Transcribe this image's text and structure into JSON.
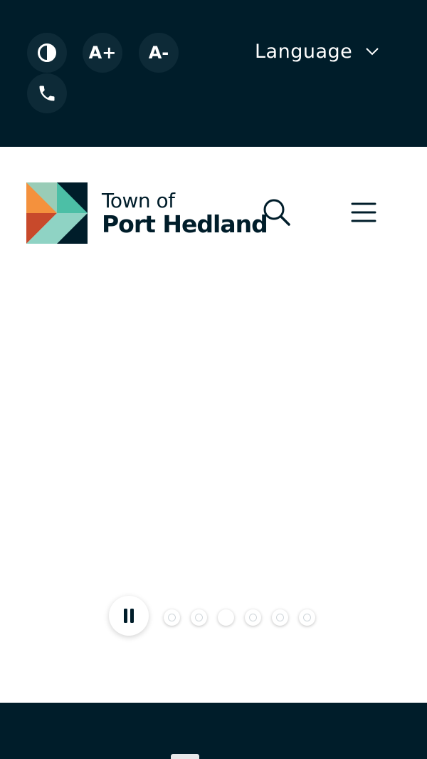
{
  "utility": {
    "contrast_icon": "contrast-icon",
    "increase_text": "A+",
    "decrease_text": "A-",
    "phone_icon": "phone-icon",
    "language_label": "Language",
    "language_chevron": "chevron-down-icon"
  },
  "header": {
    "logo_line1": "Town of",
    "logo_line2": "Port Hedland",
    "search_icon": "search-icon",
    "menu_icon": "hamburger-menu-icon"
  },
  "carousel": {
    "pause_icon": "pause-icon",
    "slide_count": 6,
    "active_index": 2
  },
  "colors": {
    "navy": "#001d2a",
    "teal": "#4cbfa6",
    "mint": "#8fd3c4",
    "orange": "#f4913d",
    "rust": "#c8492b"
  }
}
